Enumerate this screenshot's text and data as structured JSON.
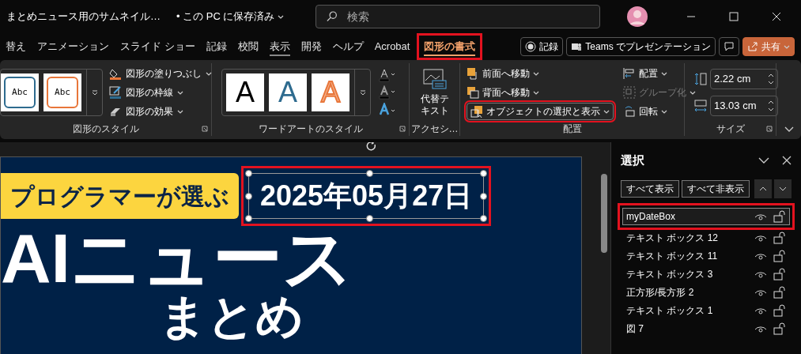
{
  "title_bar": {
    "document_title": "まとめニュース用のサムネイル…",
    "save_status": "• この PC に保存済み",
    "search": {
      "placeholder": "検索"
    }
  },
  "ribbon_tabs": [
    {
      "label": "替え",
      "selected": false,
      "underlined": false,
      "highlighted": false
    },
    {
      "label": "アニメーション",
      "selected": false,
      "underlined": false,
      "highlighted": false
    },
    {
      "label": "スライド ショー",
      "selected": false,
      "underlined": false,
      "highlighted": false
    },
    {
      "label": "記録",
      "selected": false,
      "underlined": false,
      "highlighted": false
    },
    {
      "label": "校閲",
      "selected": false,
      "underlined": false,
      "highlighted": false
    },
    {
      "label": "表示",
      "selected": false,
      "underlined": true,
      "highlighted": false
    },
    {
      "label": "開発",
      "selected": false,
      "underlined": false,
      "highlighted": false
    },
    {
      "label": "ヘルプ",
      "selected": false,
      "underlined": false,
      "highlighted": false
    },
    {
      "label": "Acrobat",
      "selected": false,
      "underlined": false,
      "highlighted": false
    },
    {
      "label": "図形の書式",
      "selected": true,
      "underlined": true,
      "highlighted": true
    }
  ],
  "header_buttons": [
    {
      "kind": "record",
      "label": "記録"
    },
    {
      "kind": "teams",
      "label": "Teams でプレゼンテーション"
    },
    {
      "kind": "comment"
    },
    {
      "kind": "share",
      "label": "共有"
    }
  ],
  "shape_styles": {
    "label": "図形のスタイル",
    "gallery": [
      {
        "text": "Abc",
        "color": "#2e6b8f"
      },
      {
        "text": "Abc",
        "color": "#e8763a"
      }
    ],
    "commands": [
      {
        "kind": "fill",
        "label": "図形の塗りつぶし"
      },
      {
        "kind": "outline",
        "label": "図形の枠線"
      },
      {
        "kind": "effect",
        "label": "図形の効果"
      }
    ]
  },
  "wordart_styles": {
    "label": "ワードアートのスタイル",
    "gallery": [
      {
        "text": "A",
        "kind": "black"
      },
      {
        "text": "A",
        "kind": "blue"
      },
      {
        "text": "A",
        "kind": "orange"
      }
    ]
  },
  "accessibility": {
    "label": "アクセシ…",
    "command": "代替テキスト"
  },
  "arrange": {
    "label": "配置",
    "commands": [
      {
        "kind": "front",
        "label": "前面へ移動",
        "disabled": false,
        "highlighted": false
      },
      {
        "kind": "back",
        "label": "背面へ移動",
        "disabled": false,
        "highlighted": false
      },
      {
        "kind": "pane",
        "label": "オブジェクトの選択と表示",
        "disabled": false,
        "highlighted": true
      },
      {
        "kind": "align",
        "label": "配置",
        "disabled": false,
        "highlighted": false
      },
      {
        "kind": "group",
        "label": "グループ化",
        "disabled": true,
        "highlighted": false
      },
      {
        "kind": "rotate",
        "label": "回転",
        "disabled": false,
        "highlighted": false
      }
    ]
  },
  "size": {
    "label": "サイズ",
    "height": "2.22 cm",
    "width": "13.03 cm"
  },
  "slide": {
    "tagline": "プログラマーが選ぶ",
    "date": "2025年05月27日",
    "date_selected": true,
    "title": "AIニュース",
    "subtitle": "まとめ"
  },
  "selection_pane": {
    "title": "選択",
    "buttons": [
      "すべて表示",
      "すべて非表示"
    ],
    "items": [
      {
        "name": "myDateBox",
        "selected": true,
        "highlighted": true
      },
      {
        "name": "テキスト ボックス 12",
        "selected": false,
        "highlighted": false
      },
      {
        "name": "テキスト ボックス 11",
        "selected": false,
        "highlighted": false
      },
      {
        "name": "テキスト ボックス 3",
        "selected": false,
        "highlighted": false
      },
      {
        "name": "正方形/長方形 2",
        "selected": false,
        "highlighted": false
      },
      {
        "name": "テキスト ボックス 1",
        "selected": false,
        "highlighted": false
      },
      {
        "name": "図 7",
        "selected": false,
        "highlighted": false
      }
    ]
  }
}
